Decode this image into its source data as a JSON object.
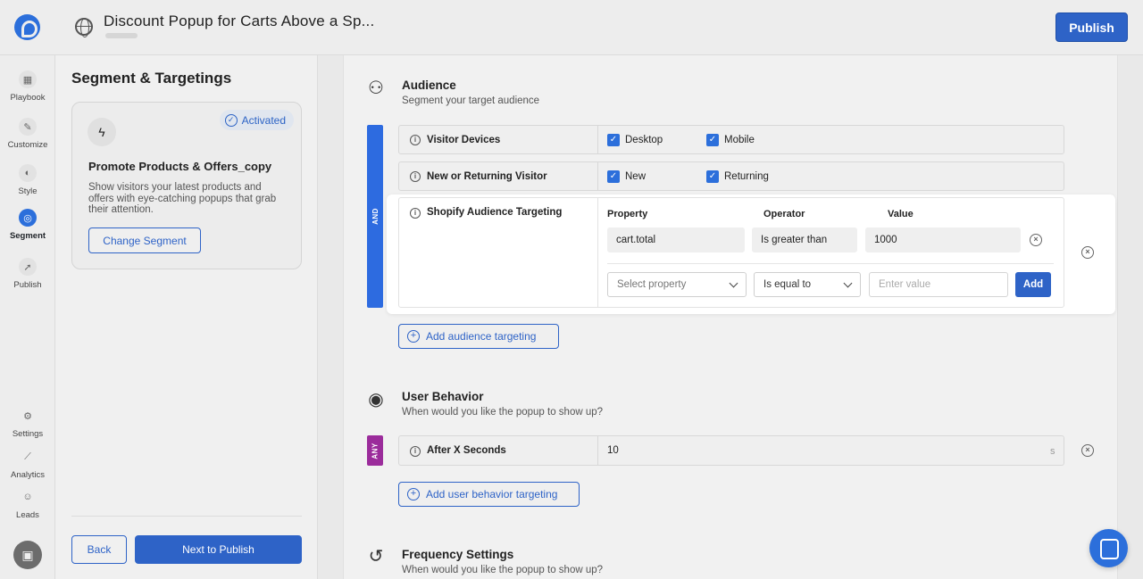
{
  "header": {
    "title": "Discount Popup for Carts Above a Sp...",
    "publish_label": "Publish"
  },
  "rail": {
    "items": [
      {
        "label": "Playbook",
        "icon": "grid-icon"
      },
      {
        "label": "Customize",
        "icon": "pencil-icon"
      },
      {
        "label": "Style",
        "icon": "palette-icon"
      },
      {
        "label": "Segment",
        "icon": "target-icon",
        "active": true
      },
      {
        "label": "Publish",
        "icon": "rocket-icon"
      },
      {
        "label": "Settings",
        "icon": "gear-icon"
      },
      {
        "label": "Analytics",
        "icon": "chart-line-icon"
      },
      {
        "label": "Leads",
        "icon": "users-icon"
      }
    ]
  },
  "panel": {
    "title": "Segment & Targetings",
    "segment": {
      "status": "Activated",
      "name": "Promote Products & Offers_copy",
      "description": "Show visitors your latest products and offers with eye-catching popups that grab their attention.",
      "change_label": "Change Segment"
    },
    "back_label": "Back",
    "next_label": "Next to Publish"
  },
  "audience": {
    "title": "Audience",
    "subtitle": "Segment your target audience",
    "logic_label": "AND",
    "rows": {
      "devices": {
        "label": "Visitor Devices",
        "options": [
          "Desktop",
          "Mobile"
        ]
      },
      "visitor": {
        "label": "New or Returning Visitor",
        "options": [
          "New",
          "Returning"
        ]
      },
      "shopify": {
        "label": "Shopify Audience Targeting",
        "headers": {
          "property": "Property",
          "operator": "Operator",
          "value": "Value"
        },
        "rule": {
          "property": "cart.total",
          "operator": "Is greater than",
          "value": "1000"
        },
        "new_rule": {
          "property_placeholder": "Select property",
          "operator": "Is equal to",
          "value_placeholder": "Enter value",
          "add_label": "Add"
        }
      }
    },
    "add_label": "Add audience targeting"
  },
  "behavior": {
    "title": "User Behavior",
    "subtitle": "When would you like the popup to show up?",
    "logic_label": "ANY",
    "rule": {
      "label": "After X Seconds",
      "value": "10",
      "unit": "s"
    },
    "add_label": "Add user behavior targeting"
  },
  "frequency": {
    "title": "Frequency Settings",
    "subtitle": "When would you like the popup to show up?"
  },
  "colors": {
    "primary": "#2e63c7",
    "and_bar": "#2d6be0",
    "any_bar": "#9b2c9b"
  }
}
